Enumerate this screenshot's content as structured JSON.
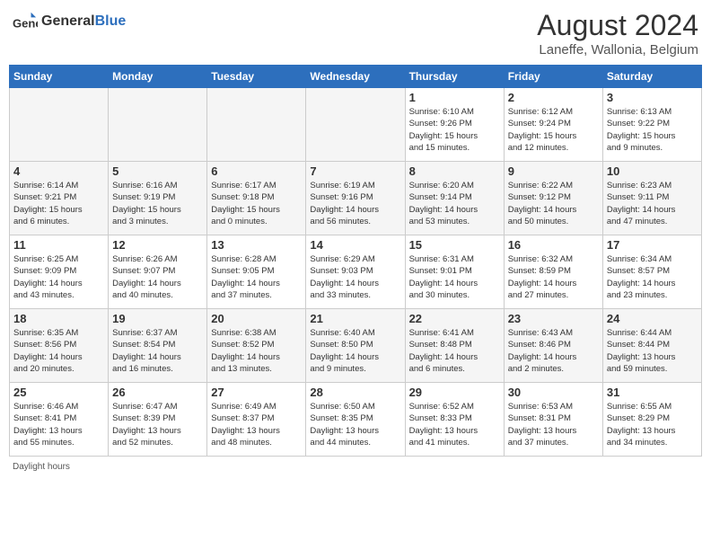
{
  "header": {
    "logo_general": "General",
    "logo_blue": "Blue",
    "title": "August 2024",
    "location": "Laneffe, Wallonia, Belgium"
  },
  "days_of_week": [
    "Sunday",
    "Monday",
    "Tuesday",
    "Wednesday",
    "Thursday",
    "Friday",
    "Saturday"
  ],
  "weeks": [
    {
      "shade": "white",
      "days": [
        {
          "num": "",
          "info": "",
          "empty": true
        },
        {
          "num": "",
          "info": "",
          "empty": true
        },
        {
          "num": "",
          "info": "",
          "empty": true
        },
        {
          "num": "",
          "info": "",
          "empty": true
        },
        {
          "num": "1",
          "info": "Sunrise: 6:10 AM\nSunset: 9:26 PM\nDaylight: 15 hours\nand 15 minutes."
        },
        {
          "num": "2",
          "info": "Sunrise: 6:12 AM\nSunset: 9:24 PM\nDaylight: 15 hours\nand 12 minutes."
        },
        {
          "num": "3",
          "info": "Sunrise: 6:13 AM\nSunset: 9:22 PM\nDaylight: 15 hours\nand 9 minutes."
        }
      ]
    },
    {
      "shade": "shade",
      "days": [
        {
          "num": "4",
          "info": "Sunrise: 6:14 AM\nSunset: 9:21 PM\nDaylight: 15 hours\nand 6 minutes."
        },
        {
          "num": "5",
          "info": "Sunrise: 6:16 AM\nSunset: 9:19 PM\nDaylight: 15 hours\nand 3 minutes."
        },
        {
          "num": "6",
          "info": "Sunrise: 6:17 AM\nSunset: 9:18 PM\nDaylight: 15 hours\nand 0 minutes."
        },
        {
          "num": "7",
          "info": "Sunrise: 6:19 AM\nSunset: 9:16 PM\nDaylight: 14 hours\nand 56 minutes."
        },
        {
          "num": "8",
          "info": "Sunrise: 6:20 AM\nSunset: 9:14 PM\nDaylight: 14 hours\nand 53 minutes."
        },
        {
          "num": "9",
          "info": "Sunrise: 6:22 AM\nSunset: 9:12 PM\nDaylight: 14 hours\nand 50 minutes."
        },
        {
          "num": "10",
          "info": "Sunrise: 6:23 AM\nSunset: 9:11 PM\nDaylight: 14 hours\nand 47 minutes."
        }
      ]
    },
    {
      "shade": "white",
      "days": [
        {
          "num": "11",
          "info": "Sunrise: 6:25 AM\nSunset: 9:09 PM\nDaylight: 14 hours\nand 43 minutes."
        },
        {
          "num": "12",
          "info": "Sunrise: 6:26 AM\nSunset: 9:07 PM\nDaylight: 14 hours\nand 40 minutes."
        },
        {
          "num": "13",
          "info": "Sunrise: 6:28 AM\nSunset: 9:05 PM\nDaylight: 14 hours\nand 37 minutes."
        },
        {
          "num": "14",
          "info": "Sunrise: 6:29 AM\nSunset: 9:03 PM\nDaylight: 14 hours\nand 33 minutes."
        },
        {
          "num": "15",
          "info": "Sunrise: 6:31 AM\nSunset: 9:01 PM\nDaylight: 14 hours\nand 30 minutes."
        },
        {
          "num": "16",
          "info": "Sunrise: 6:32 AM\nSunset: 8:59 PM\nDaylight: 14 hours\nand 27 minutes."
        },
        {
          "num": "17",
          "info": "Sunrise: 6:34 AM\nSunset: 8:57 PM\nDaylight: 14 hours\nand 23 minutes."
        }
      ]
    },
    {
      "shade": "shade",
      "days": [
        {
          "num": "18",
          "info": "Sunrise: 6:35 AM\nSunset: 8:56 PM\nDaylight: 14 hours\nand 20 minutes."
        },
        {
          "num": "19",
          "info": "Sunrise: 6:37 AM\nSunset: 8:54 PM\nDaylight: 14 hours\nand 16 minutes."
        },
        {
          "num": "20",
          "info": "Sunrise: 6:38 AM\nSunset: 8:52 PM\nDaylight: 14 hours\nand 13 minutes."
        },
        {
          "num": "21",
          "info": "Sunrise: 6:40 AM\nSunset: 8:50 PM\nDaylight: 14 hours\nand 9 minutes."
        },
        {
          "num": "22",
          "info": "Sunrise: 6:41 AM\nSunset: 8:48 PM\nDaylight: 14 hours\nand 6 minutes."
        },
        {
          "num": "23",
          "info": "Sunrise: 6:43 AM\nSunset: 8:46 PM\nDaylight: 14 hours\nand 2 minutes."
        },
        {
          "num": "24",
          "info": "Sunrise: 6:44 AM\nSunset: 8:44 PM\nDaylight: 13 hours\nand 59 minutes."
        }
      ]
    },
    {
      "shade": "white",
      "days": [
        {
          "num": "25",
          "info": "Sunrise: 6:46 AM\nSunset: 8:41 PM\nDaylight: 13 hours\nand 55 minutes."
        },
        {
          "num": "26",
          "info": "Sunrise: 6:47 AM\nSunset: 8:39 PM\nDaylight: 13 hours\nand 52 minutes."
        },
        {
          "num": "27",
          "info": "Sunrise: 6:49 AM\nSunset: 8:37 PM\nDaylight: 13 hours\nand 48 minutes."
        },
        {
          "num": "28",
          "info": "Sunrise: 6:50 AM\nSunset: 8:35 PM\nDaylight: 13 hours\nand 44 minutes."
        },
        {
          "num": "29",
          "info": "Sunrise: 6:52 AM\nSunset: 8:33 PM\nDaylight: 13 hours\nand 41 minutes."
        },
        {
          "num": "30",
          "info": "Sunrise: 6:53 AM\nSunset: 8:31 PM\nDaylight: 13 hours\nand 37 minutes."
        },
        {
          "num": "31",
          "info": "Sunrise: 6:55 AM\nSunset: 8:29 PM\nDaylight: 13 hours\nand 34 minutes."
        }
      ]
    }
  ],
  "footer": {
    "daylight_hours": "Daylight hours"
  }
}
